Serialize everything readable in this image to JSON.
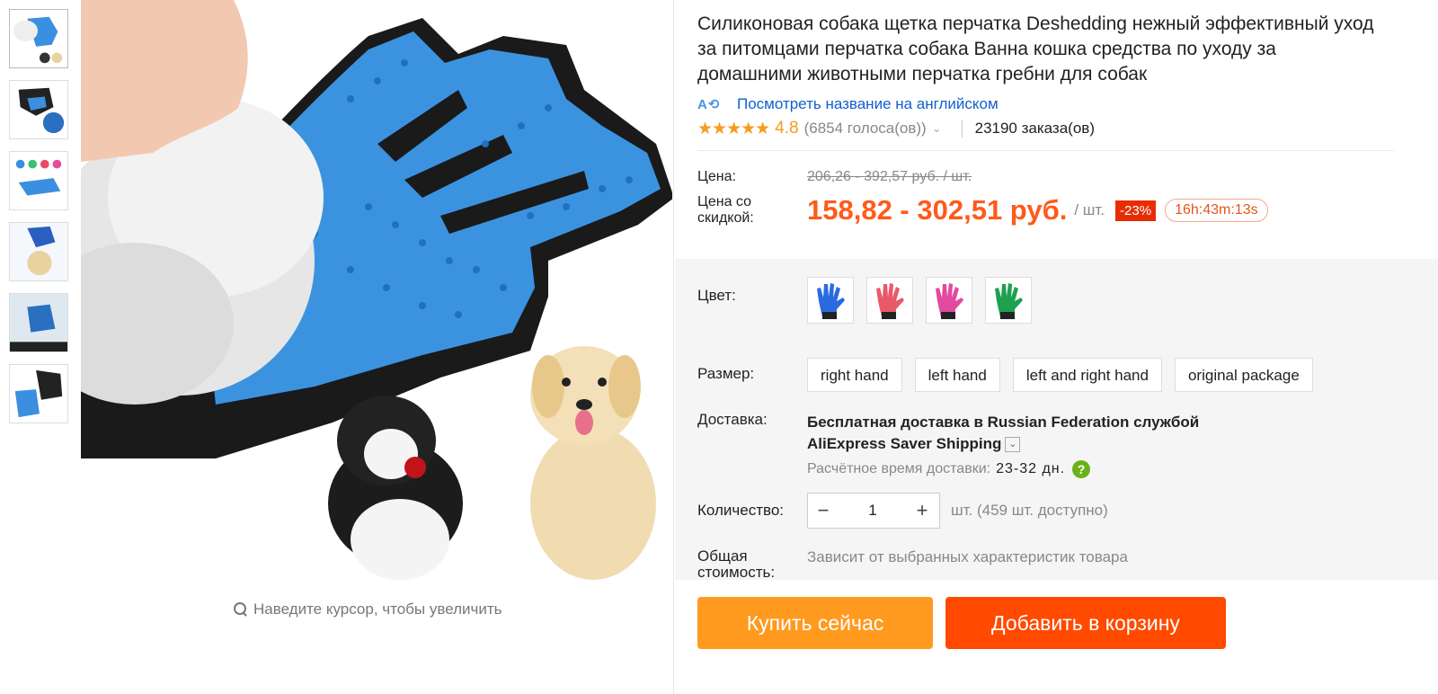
{
  "product": {
    "title": "Силиконовая собака щетка перчатка Deshedding нежный эффективный уход за питомцами перчатка собака Ванна кошка средства по уходу за домашними животными перчатка гребни для собак",
    "translate_link": "Посмотреть название на английском",
    "translate_icon": "translate-icon"
  },
  "rating": {
    "stars": "★★★★★",
    "value": "4.8",
    "votes": "(6854 голоса(ов))",
    "orders": "23190 заказа(ов)"
  },
  "price": {
    "label": "Цена:",
    "old": "206,26 - 392,57 руб. / шт.",
    "discount_label": "Цена со скидкой:",
    "new": "158,82 - 302,51 руб.",
    "per_unit": "/ шт.",
    "discount_badge": "-23%",
    "timer": "16h:43m:13s",
    "accent_color": "#ff5a1a"
  },
  "color": {
    "label": "Цвет:",
    "options": [
      "blue",
      "red",
      "pink",
      "green"
    ]
  },
  "size": {
    "label": "Размер:",
    "options": [
      "right hand",
      "left hand",
      "left and right hand",
      "original package"
    ]
  },
  "shipping": {
    "label": "Доставка:",
    "main_line1": "Бесплатная доставка в Russian Federation службой",
    "main_line2": "AliExpress Saver Shipping",
    "time_label": "Расчётное время доставки:",
    "time_value": "23-32 дн."
  },
  "quantity": {
    "label": "Количество:",
    "value": "1",
    "available": "шт. (459 шт. доступно)"
  },
  "total": {
    "label": "Общая стоимость:",
    "value": "Зависит от выбранных характеристик товара"
  },
  "gallery": {
    "zoom_hint": "Наведите курсор, чтобы увеличить"
  },
  "actions": {
    "buy_now": "Купить сейчас",
    "add_to_cart": "Добавить в корзину"
  }
}
